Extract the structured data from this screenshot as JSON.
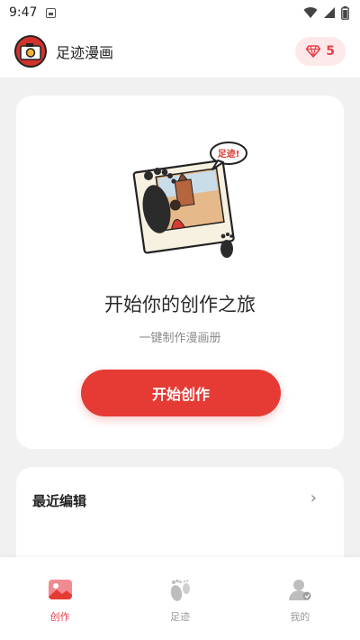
{
  "status_bar": {
    "time": "9:47"
  },
  "header": {
    "app_title": "足迹漫画",
    "gem_count": "5"
  },
  "create_card": {
    "speech_bubble_text": "足迹!",
    "title": "开始你的创作之旅",
    "subtitle": "一键制作漫画册",
    "start_button_label": "开始创作"
  },
  "recent": {
    "title": "最近编辑",
    "chevron": "›"
  },
  "bottom_nav": {
    "items": [
      {
        "label": "创作",
        "icon": "create-image-icon",
        "active": true
      },
      {
        "label": "足迹",
        "icon": "footprint-icon",
        "active": false
      },
      {
        "label": "我的",
        "icon": "profile-icon",
        "active": false
      }
    ]
  },
  "colors": {
    "accent": "#e63b35",
    "badge_bg": "#fde8ea",
    "background": "#f1f1f1"
  }
}
